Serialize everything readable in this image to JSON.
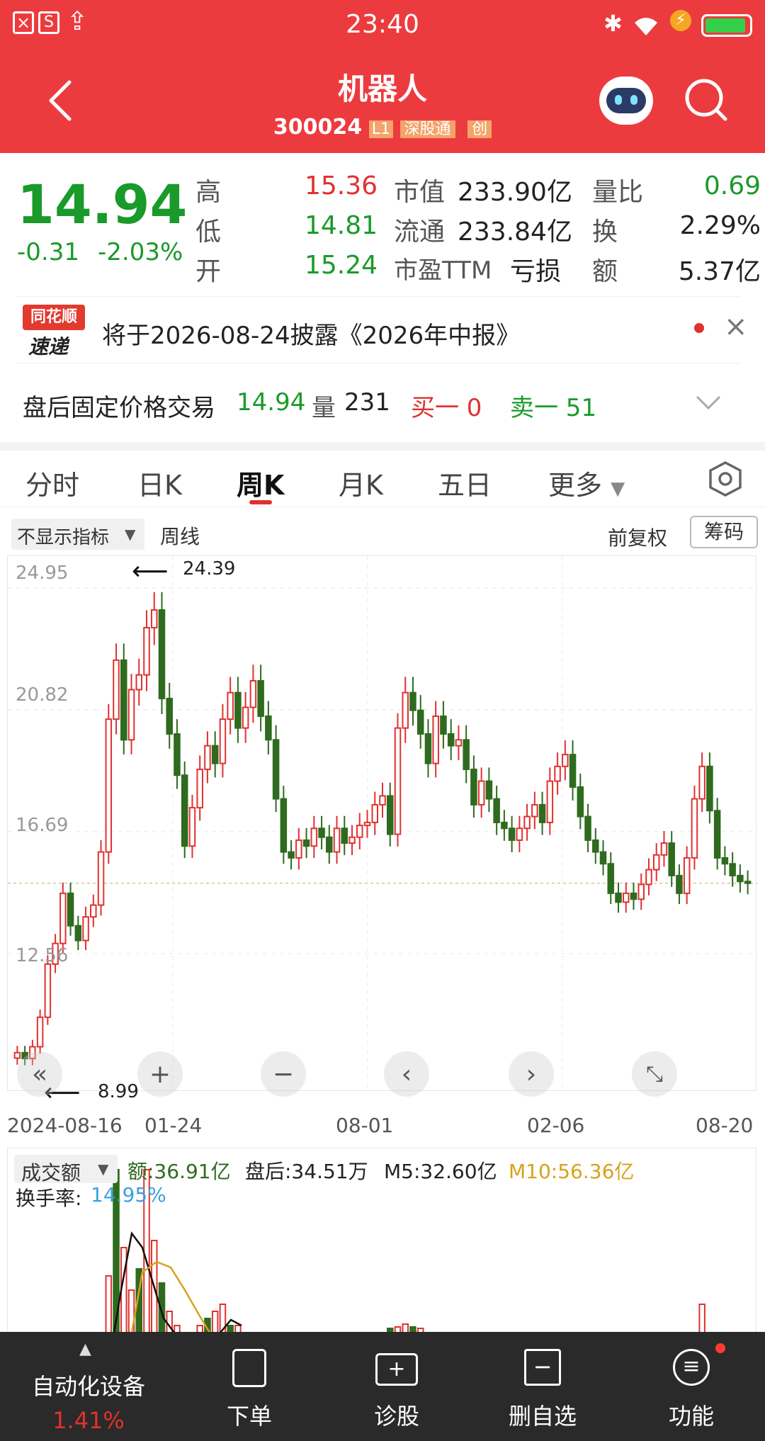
{
  "status_bar": {
    "time": "23:40"
  },
  "header": {
    "title": "机器人",
    "code": "300024",
    "badge_l1": "L1",
    "badge_sgt": "深股通",
    "badge_chuang": "创"
  },
  "quote": {
    "price": "14.94",
    "change": "-0.31",
    "change_pct": "-2.03%",
    "high_label": "高",
    "high": "15.36",
    "low_label": "低",
    "low": "14.81",
    "open_label": "开",
    "open": "15.24",
    "mcap_label": "市值",
    "mcap": "233.90亿",
    "float_label": "流通",
    "float": "233.84亿",
    "pe_label": "市盈TTM",
    "pe": "亏损",
    "vr_label": "量比",
    "vr": "0.69",
    "turn_label": "换",
    "turn": "2.29%",
    "amt_label": "额",
    "amt": "5.37亿"
  },
  "news": {
    "logo_top": "同花顺",
    "logo_bottom": "速递",
    "text": "将于2026-08-24披露《2026年中报》"
  },
  "after_hours": {
    "label": "盘后固定价格交易",
    "price": "14.94",
    "vol_label": "量",
    "vol": "231",
    "bid": "买一 0",
    "ask": "卖一 51"
  },
  "tabs": [
    "分时",
    "日K",
    "周K",
    "月K",
    "五日",
    "更多"
  ],
  "active_tab": "周K",
  "toolbar": {
    "indicator": "不显示指标",
    "period": "周线",
    "adjust": "前复权",
    "chips": "筹码"
  },
  "chart_data": {
    "type": "candlestick",
    "y_ticks": [
      "24.95",
      "20.82",
      "16.69",
      "12.56"
    ],
    "ylim": [
      8.5,
      25.4
    ],
    "x_ticks": [
      "2024-08-16",
      "01-24",
      "08-01",
      "02-06",
      "08-20"
    ],
    "max_label": "24.39",
    "min_label": "8.99",
    "reference_price": 14.94
  },
  "volume": {
    "selector": "成交额",
    "amount": "额:36.91亿",
    "after": "盘后:34.51万",
    "m5": "M5:32.60亿",
    "m10": "M10:56.36亿",
    "turnover_label": "换手率:",
    "turnover": "14.95%"
  },
  "bottom_bar": {
    "sector": "自动化设备",
    "sector_pct": "1.41%",
    "order": "下单",
    "diagnose": "诊股",
    "remove": "删自选",
    "func": "功能"
  },
  "colors": {
    "header": "#ec3b3f",
    "up": "#e0312f",
    "down": "#2e6b1f",
    "price_green": "#1a9a2a"
  }
}
